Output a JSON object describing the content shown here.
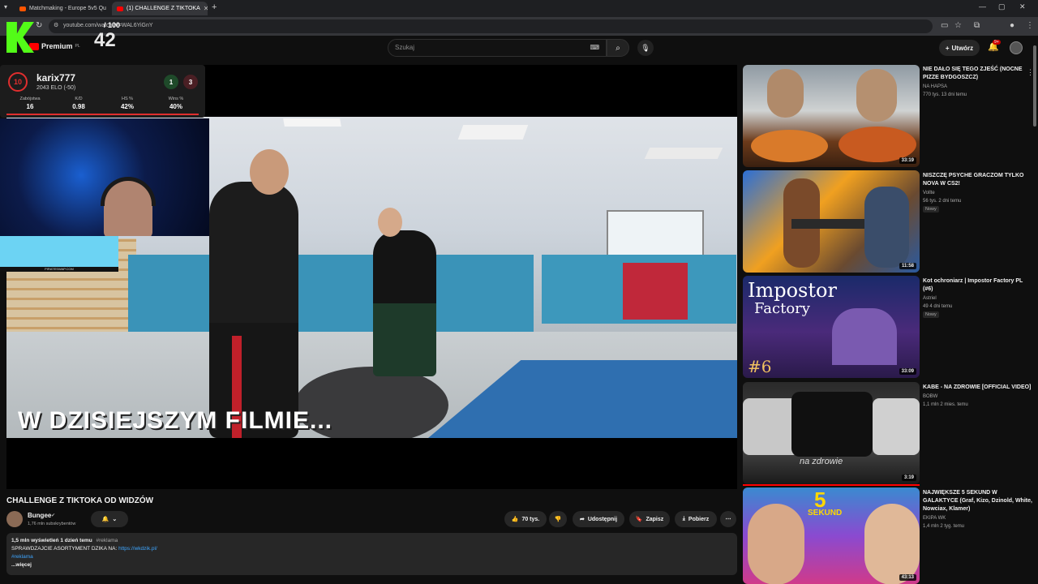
{
  "browser": {
    "tabs": [
      {
        "label": "Matchmaking - Europe 5v5 Qu"
      },
      {
        "label": "(1) CHALLENGE Z TIKTOKA"
      }
    ],
    "url": "youtube.com/watch?v=WAL6YiGnY"
  },
  "youtube": {
    "premium_label": "Premium",
    "premium_sup": "PL",
    "search_placeholder": "Szukaj",
    "create_label": "Utwórz",
    "notif_count": "9+"
  },
  "overlay": {
    "score_small": "/ 100",
    "score_big": "42"
  },
  "faceit": {
    "level": "10",
    "name": "karix777",
    "elo": "2043 ELO (-50)",
    "wins": "1",
    "losses": "3",
    "stats": [
      {
        "key": "Zabójstwa",
        "value": "16"
      },
      {
        "key": "K/D",
        "value": "0.98"
      },
      {
        "key": "HS %",
        "value": "42%"
      },
      {
        "key": "Wins %",
        "value": "40%"
      }
    ],
    "banner_text": "PIRATESWAP.COM"
  },
  "video": {
    "subtitle": "W DZISIEJSZYM FILMIE...",
    "title": "CHALLENGE Z TIKTOKA OD WIDZÓW",
    "channel": "Bungee",
    "subs": "1,76 mln subskrybentów",
    "likes": "70 tys.",
    "share": "Udostępnij",
    "save": "Zapisz",
    "download": "Pobierz"
  },
  "description": {
    "stats": "1,5 mln wyświetleń  1 dzień temu",
    "tag": "#reklama",
    "line1": "SPRAWDZAJCIE ASORTYMENT DZIKA NA: ",
    "link": "https://wkdzik.pl/",
    "line2": "#reklama",
    "more": "...więcej"
  },
  "sidebar": [
    {
      "title": "NIE DAŁO SIĘ TEGO ZJEŚĆ (NOCNE PIZZE BYDGOSZCZ)",
      "channel": "NA HAPSA",
      "meta": "770 tys.  13 dni temu",
      "duration": "33:19",
      "isnew": ""
    },
    {
      "title": "NISZCZĘ PSYCHE GRACZOM TYLKO NOVA W CS2!",
      "channel": "Vollte",
      "meta": "56 tys.  2 dni temu",
      "duration": "11:58",
      "isnew": "Nowy"
    },
    {
      "title": "Kot ochroniarz | Impostor Factory PL (#6)",
      "channel": "Astriel",
      "meta": "49  4 dni temu",
      "duration": "33:09",
      "isnew": "Nowy",
      "thumb_text1": "Impostor",
      "thumb_text2": "Factory",
      "thumb_num": "#6"
    },
    {
      "title": "KABE - NA ZDROWIE [OFFICIAL VIDEO]",
      "channel": "BOBW",
      "meta": "1,1 mln  2 mies. temu",
      "duration": "3:19",
      "isnew": "",
      "thumb_text1": "na zdrowie"
    },
    {
      "title": "NAJWIĘKSZE 5 SEKUND W GALAKTYCE (Graf, Kizo, Dzinold, White, Nowciax, Klamer)",
      "channel": "EKIPA WK",
      "meta": "1,4 mln  2 tyg. temu",
      "duration": "43:13",
      "isnew": "",
      "thumb_text1": "5",
      "thumb_text2": "SEKUND"
    }
  ]
}
